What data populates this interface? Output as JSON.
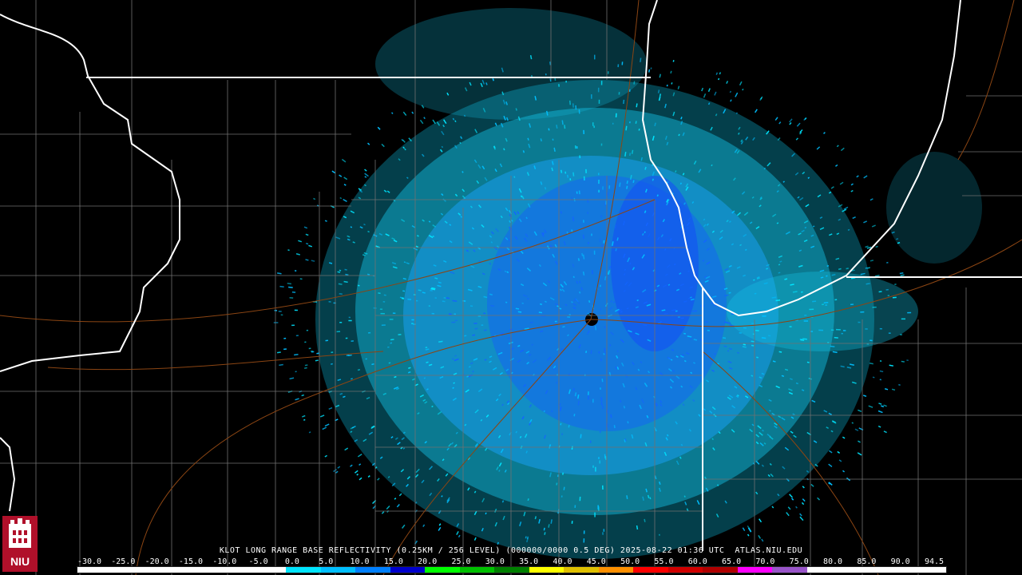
{
  "product": {
    "caption": "KLOT LONG RANGE BASE REFLECTIVITY (0.25KM / 256 LEVEL) (000000/0000 0.5 DEG) 2025-08-22 01:36 UTC  ATLAS.NIU.EDU"
  },
  "legend": {
    "ticks": [
      "-30.0",
      "-25.0",
      "-20.0",
      "-15.0",
      "-10.0",
      "-5.0",
      "0.0",
      "5.0",
      "10.0",
      "15.0",
      "20.0",
      "25.0",
      "30.0",
      "35.0",
      "40.0",
      "45.0",
      "50.0",
      "55.0",
      "60.0",
      "65.0",
      "70.0",
      "75.0",
      "80.0",
      "85.0",
      "90.0",
      "94.5"
    ],
    "colors": [
      "#ffffff",
      "#ffffff",
      "#ffffff",
      "#ffffff",
      "#ffffff",
      "#ffffff",
      "#00e5ff",
      "#00bfff",
      "#0080ff",
      "#0000cd",
      "#00ff00",
      "#00c000",
      "#008000",
      "#ffff00",
      "#e0c000",
      "#ff9000",
      "#ff0000",
      "#d00000",
      "#b00000",
      "#ff00ff",
      "#9955c9",
      "#ffffff",
      "#ffffff",
      "#ffffff",
      "#ffffff"
    ]
  },
  "logo": {
    "text": "NIU"
  },
  "colors": {
    "background": "#000000",
    "boundary": "#ffffff",
    "county": "#707070",
    "road": "#8b4513",
    "echo_light": "#00e5ff",
    "echo_mid": "#00bfff",
    "echo_dense": "#1464ff"
  }
}
